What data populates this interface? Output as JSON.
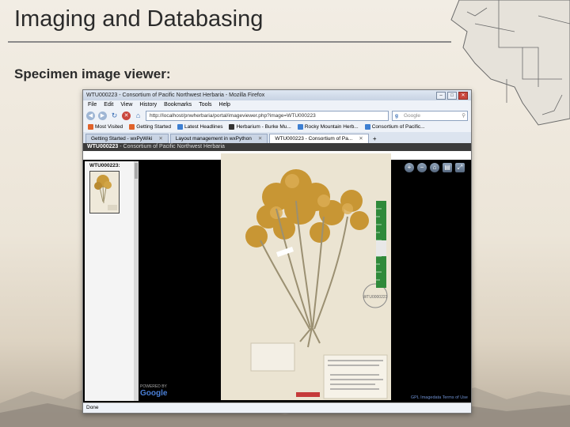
{
  "slide": {
    "title": "Imaging and Databasing",
    "subtitle": "Specimen image viewer:"
  },
  "browser": {
    "window_title": "WTU000223 - Consortium of Pacific Northwest Herbaria - Mozilla Firefox",
    "menu": [
      "File",
      "Edit",
      "View",
      "History",
      "Bookmarks",
      "Tools",
      "Help"
    ],
    "url": "http://localhost/pnwherbaria/portal/imageviewer.php?image=WTU000223",
    "search_engine": "Google",
    "bookmarks": [
      {
        "label": "Most Visited",
        "color": "#e0632b"
      },
      {
        "label": "Getting Started",
        "color": "#e0632b"
      },
      {
        "label": "Latest Headlines",
        "color": "#3d7fd2"
      },
      {
        "label": "Herbarium - Burke Mu...",
        "color": "#333333"
      },
      {
        "label": "Rocky Mountain Herb...",
        "color": "#3d7fd2"
      },
      {
        "label": "Consortium of Pacific...",
        "color": "#3d7fd2"
      }
    ],
    "tabs": [
      {
        "label": "Getting Started - wxPyWiki",
        "active": false
      },
      {
        "label": "Layout management in wxPython",
        "active": false
      },
      {
        "label": "WTU000223 - Consortium of Pa...",
        "active": true
      }
    ],
    "status": "Done"
  },
  "viewer": {
    "header_id": "WTU000223",
    "header_sub": " - Consortium of Pacific Northwest Herbaria",
    "sidebar_label": "WTU000223:",
    "google_powered": "POWERED BY",
    "google_logo": "Google",
    "footer_links": "GPL Imagedata   Terms of Use",
    "stamp": "WTU0000223"
  }
}
